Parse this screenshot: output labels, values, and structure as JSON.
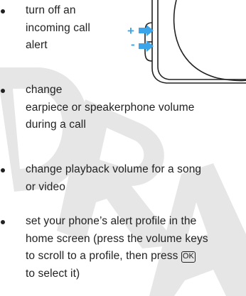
{
  "watermark": {
    "text": "DRAFT",
    "color": "#e6e6e6"
  },
  "figure": {
    "volume_up_label": "+",
    "volume_down_label": "-",
    "arrow_color": "#3aa5ea",
    "icons": [
      "phone-side-outline",
      "volume-up-arrow",
      "volume-down-arrow"
    ]
  },
  "bullets": [
    {
      "lines": [
        "turn off an",
        "incoming call",
        "alert"
      ]
    },
    {
      "lines": [
        "change",
        "earpiece or speakerphone volume",
        "during a call"
      ]
    },
    {
      "lines": [
        "change playback volume for a song",
        "or video"
      ]
    },
    {
      "lines": [
        "set your phone’s alert profile in the",
        "home screen (press the volume keys",
        "to scroll to a profile, then press"
      ],
      "key_label": "OK",
      "last_line": "to select it)"
    }
  ]
}
